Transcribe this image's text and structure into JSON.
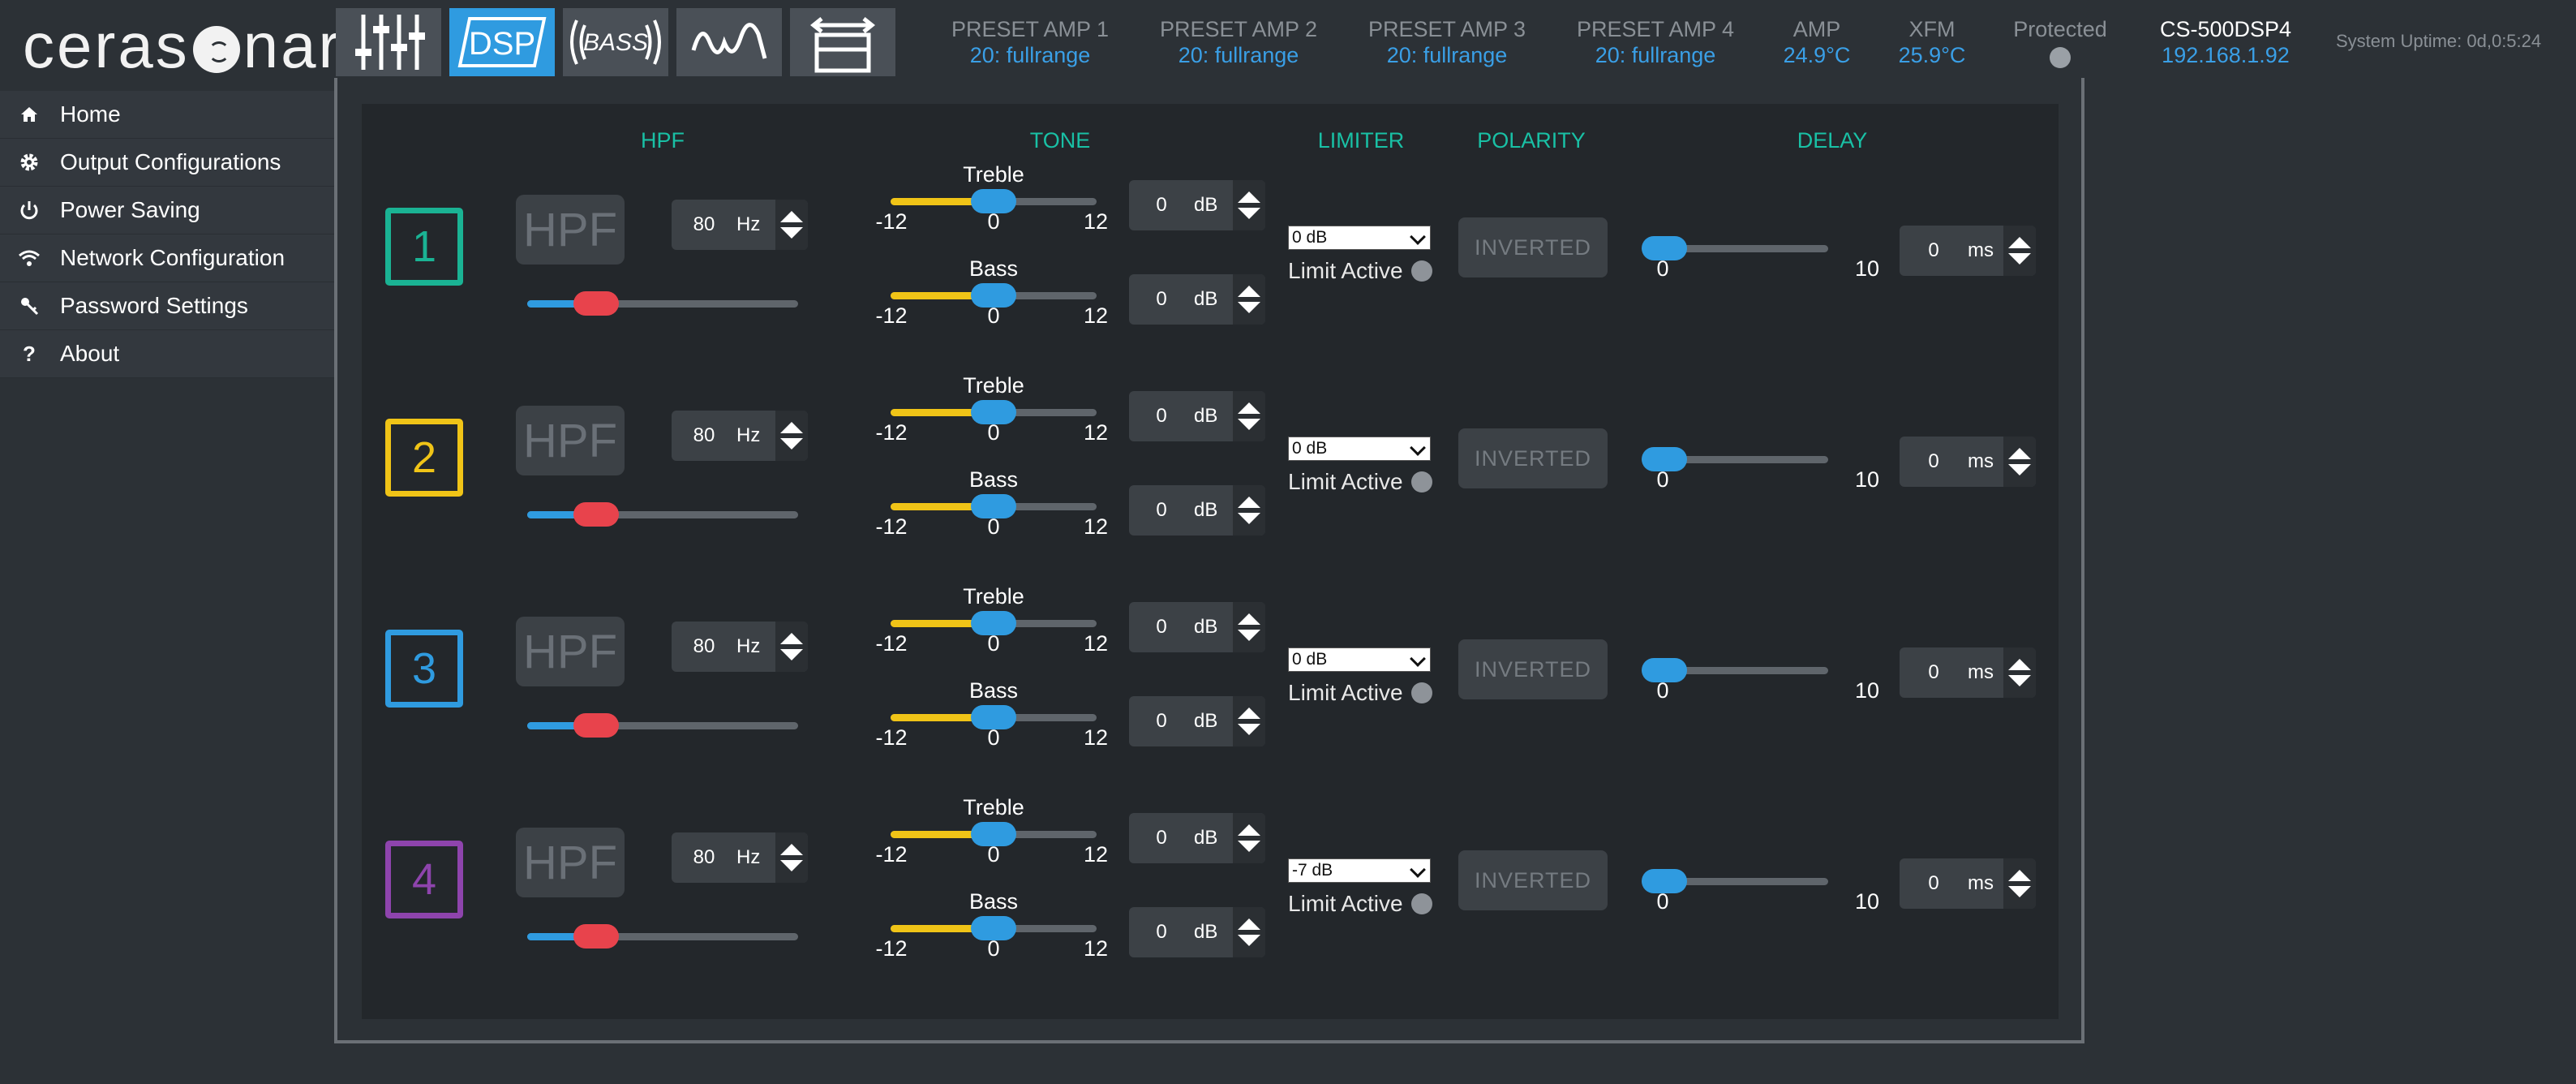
{
  "app": {
    "logo": "cerasonar",
    "logo_left": "ceras",
    "logo_right": "nar"
  },
  "toolbar": [
    {
      "name": "mixer-sliders-icon",
      "active": false
    },
    {
      "name": "dsp-icon",
      "label": "DSP",
      "active": true
    },
    {
      "name": "bass-icon",
      "label": "BASS",
      "active": false
    },
    {
      "name": "waveform-icon",
      "active": false
    },
    {
      "name": "expand-icon",
      "active": false
    }
  ],
  "status": {
    "preset1": {
      "label": "PRESET AMP 1",
      "value": "20: fullrange"
    },
    "preset2": {
      "label": "PRESET AMP 2",
      "value": "20: fullrange"
    },
    "preset3": {
      "label": "PRESET AMP 3",
      "value": "20: fullrange"
    },
    "preset4": {
      "label": "PRESET AMP 4",
      "value": "20: fullrange"
    },
    "amp": {
      "label": "AMP",
      "value": "24.9°C"
    },
    "xfm": {
      "label": "XFM",
      "value": "25.9°C"
    },
    "protected": {
      "label": "Protected"
    },
    "device": {
      "label": "CS-500DSP4",
      "value": "192.168.1.92"
    },
    "uptime": "System Uptime: 0d,0:5:24"
  },
  "sidebar": {
    "items": [
      {
        "label": "Home",
        "icon": "home-icon"
      },
      {
        "label": "Output Configurations",
        "icon": "gear-icon"
      },
      {
        "label": "Power Saving",
        "icon": "power-icon"
      },
      {
        "label": "Network Configuration",
        "icon": "wifi-icon"
      },
      {
        "label": "Password Settings",
        "icon": "key-icon"
      },
      {
        "label": "About",
        "icon": "question-icon"
      }
    ]
  },
  "columns": {
    "hpf": "HPF",
    "tone": "TONE",
    "limiter": "LIMITER",
    "polarity": "POLARITY",
    "delay": "DELAY"
  },
  "labels": {
    "hpf_button": "HPF",
    "hz": "Hz",
    "db": "dB",
    "ms": "ms",
    "treble": "Treble",
    "bass": "Bass",
    "tone_min": "-12",
    "tone_mid": "0",
    "tone_max": "12",
    "delay_min": "0",
    "delay_max": "10",
    "limit_active": "Limit Active",
    "inverted": "INVERTED"
  },
  "channels": [
    {
      "num": "1",
      "color": "#1ab394",
      "hpf_freq": "80",
      "hpf_level": 0.2,
      "treble": "0",
      "bass": "0",
      "treble_level": 0.5,
      "bass_level": 0.5,
      "limiter": "0 dB",
      "delay": "0",
      "delay_level": 0
    },
    {
      "num": "2",
      "color": "#f0c417",
      "hpf_freq": "80",
      "hpf_level": 0.2,
      "treble": "0",
      "bass": "0",
      "treble_level": 0.5,
      "bass_level": 0.5,
      "limiter": "0 dB",
      "delay": "0",
      "delay_level": 0
    },
    {
      "num": "3",
      "color": "#2f9be0",
      "hpf_freq": "80",
      "hpf_level": 0.2,
      "treble": "0",
      "bass": "0",
      "treble_level": 0.5,
      "bass_level": 0.5,
      "limiter": "0 dB",
      "delay": "0",
      "delay_level": 0
    },
    {
      "num": "4",
      "color": "#8e44ad",
      "hpf_freq": "80",
      "hpf_level": 0.2,
      "treble": "0",
      "bass": "0",
      "treble_level": 0.5,
      "bass_level": 0.5,
      "limiter": "-7 dB",
      "delay": "0",
      "delay_level": 0
    }
  ],
  "colors": {
    "accent": "#2f9be0",
    "header_green": "#19c0a5",
    "tone_fill": "#f0c417",
    "hpf_knob": "#e8434c"
  }
}
